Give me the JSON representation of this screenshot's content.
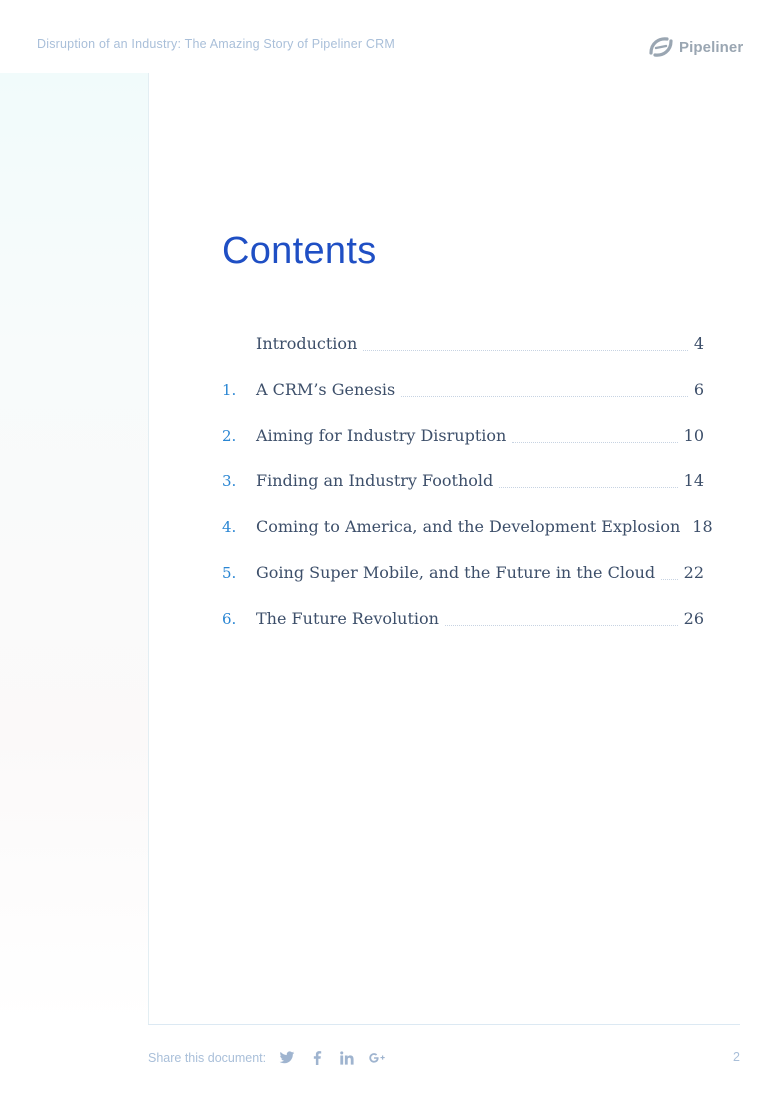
{
  "header": {
    "title": "Disruption of an Industry: The Amazing Story of Pipeliner CRM",
    "logo_text": "Pipeliner",
    "logo_icon": "pipeliner-logo-icon"
  },
  "contents": {
    "heading": "Contents",
    "entries": [
      {
        "number": "",
        "label": "Introduction",
        "page": "4"
      },
      {
        "number": "1.",
        "label": "A CRM’s Genesis",
        "page": "6"
      },
      {
        "number": "2.",
        "label": "Aiming for Industry Disruption",
        "page": "10"
      },
      {
        "number": "3.",
        "label": "Finding an Industry Foothold",
        "page": "14"
      },
      {
        "number": "4.",
        "label": "Coming to America, and the Development Explosion",
        "page": "18"
      },
      {
        "number": "5.",
        "label": "Going Super Mobile, and the Future in the Cloud",
        "page": "22"
      },
      {
        "number": "6.",
        "label": "The Future Revolution",
        "page": "26"
      }
    ]
  },
  "footer": {
    "share_label": "Share this document:",
    "share_icons": [
      "twitter-icon",
      "facebook-icon",
      "linkedin-icon",
      "google-plus-icon"
    ],
    "page_number": "2"
  },
  "colors": {
    "heading": "#1f4fc4",
    "number": "#2a86d3",
    "body_text": "#3d4f6a",
    "muted": "#a9bfd9"
  }
}
